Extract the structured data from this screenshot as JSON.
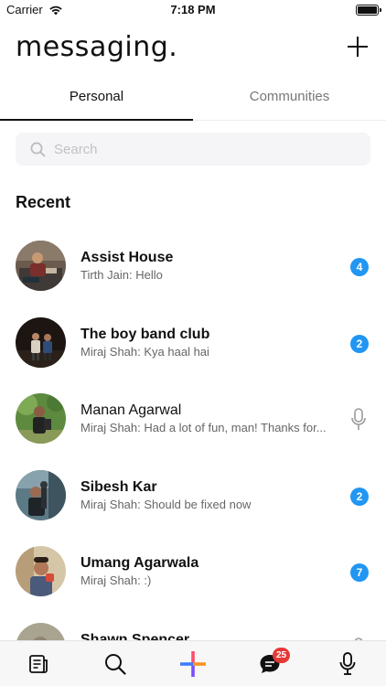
{
  "status_bar": {
    "carrier": "Carrier",
    "time": "7:18 PM"
  },
  "header": {
    "title": "messaging.",
    "add_icon": "plus-icon"
  },
  "tabs": [
    {
      "label": "Personal",
      "active": true
    },
    {
      "label": "Communities",
      "active": false
    }
  ],
  "search": {
    "placeholder": "Search",
    "value": ""
  },
  "section": {
    "title": "Recent"
  },
  "conversations": [
    {
      "name": "Assist House",
      "preview": "Tirth Jain: Hello",
      "unread": 4,
      "indicator": "badge"
    },
    {
      "name": "The boy band club",
      "preview": "Miraj Shah: Kya haal hai",
      "unread": 2,
      "indicator": "badge"
    },
    {
      "name": "Manan Agarwal",
      "preview": "Miraj Shah: Had a lot of fun, man! Thanks for...",
      "unread": null,
      "indicator": "microphone-icon"
    },
    {
      "name": "Sibesh Kar",
      "preview": "Miraj Shah: Should be fixed now",
      "unread": 2,
      "indicator": "badge"
    },
    {
      "name": "Umang Agarwala",
      "preview": "Miraj Shah: :)",
      "unread": 7,
      "indicator": "badge"
    },
    {
      "name": "Shawn Spencer",
      "preview": "",
      "unread": null,
      "indicator": "microphone-icon"
    }
  ],
  "bottom_nav": {
    "items": [
      "news-icon",
      "search-icon",
      "plus-icon",
      "chat-icon",
      "microphone-icon"
    ],
    "chat_badge": "25"
  },
  "colors": {
    "badge_blue": "#2196f3",
    "nav_badge_red": "#e53935",
    "plus_gradient": [
      "#ff4d6d",
      "#f7931e",
      "#7b4dff",
      "#3f7bff"
    ]
  }
}
